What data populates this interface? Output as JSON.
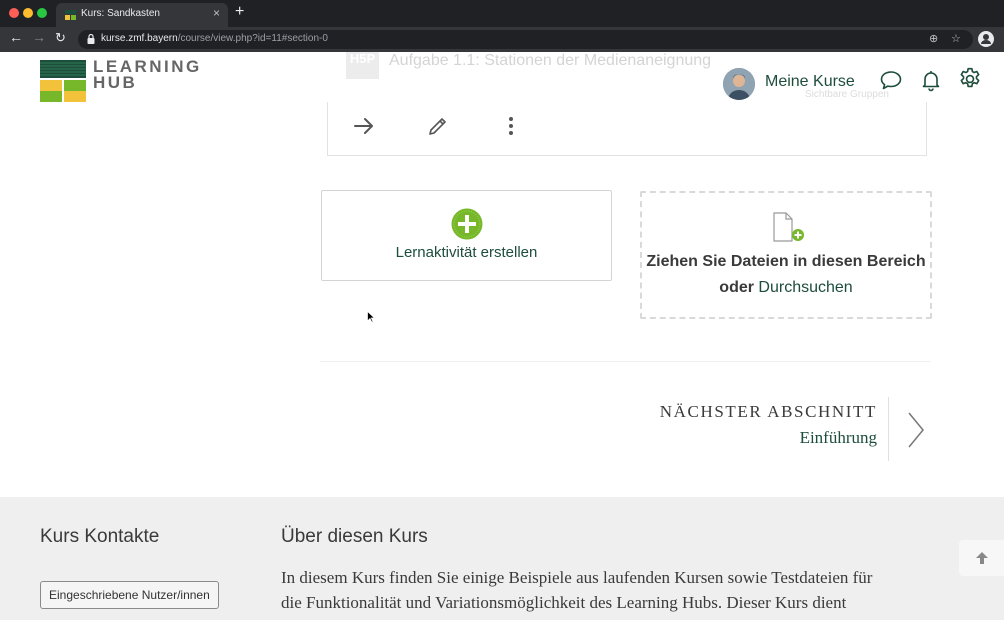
{
  "browser": {
    "tab_title": "Kurs: Sandkasten",
    "tab_close": "×",
    "new_tab": "+",
    "url_host": "kurse.zmf.bayern",
    "url_path": "/course/view.php?id=11#section-0"
  },
  "header": {
    "logo_line1": "LEARNING",
    "logo_line2": "HUB",
    "my_courses": "Meine Kurse"
  },
  "ghost": {
    "h5p": "H5P",
    "title": "Aufgabe 1.1: Stationen der Medienaneignung",
    "badge": "Sichtbare Gruppen"
  },
  "actions": {
    "create_activity": "Lernaktivität erstellen",
    "drop_files": "Ziehen Sie Dateien in diesen Bereich",
    "drop_or": "oder",
    "drop_browse": "Durchsuchen"
  },
  "next_section": {
    "label": "NÄCHSTER ABSCHNITT",
    "name": "Einführung"
  },
  "footer": {
    "contacts_title": "Kurs Kontakte",
    "enrolled_button": "Eingeschriebene Nutzer/innen",
    "about_title": "Über diesen Kurs",
    "about_line1": "In diesem Kurs finden Sie einige Beispiele aus laufenden Kursen sowie Testdateien für",
    "about_line2": "die Funktionalität und Variationsmöglichkeit des Learning Hubs. Dieser Kurs dient"
  },
  "colors": {
    "brand_green": "#1d4d3b",
    "plus_green": "#76b82a",
    "logo_yellow": "#f2c33a"
  }
}
